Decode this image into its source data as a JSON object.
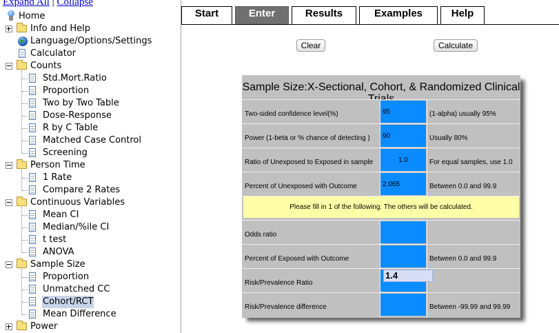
{
  "tree": {
    "expand_all": "Expand All",
    "separator": "|",
    "collapse": "Collapse",
    "nodes": [
      {
        "label": "Home",
        "icon": "home-icon",
        "level": 0
      },
      {
        "label": "Info and Help",
        "icon": "folder-icon",
        "level": 0,
        "toggle": "plus"
      },
      {
        "label": "Language/Options/Settings",
        "icon": "globe-icon",
        "level": 0
      },
      {
        "label": "Calculator",
        "icon": "document-icon",
        "level": 0
      },
      {
        "label": "Counts",
        "icon": "folder-open-icon",
        "level": 0,
        "toggle": "minus"
      },
      {
        "label": "Std.Mort.Ratio",
        "icon": "document-icon",
        "level": 1
      },
      {
        "label": "Proportion",
        "icon": "document-icon",
        "level": 1
      },
      {
        "label": "Two by Two Table",
        "icon": "document-icon",
        "level": 1
      },
      {
        "label": "Dose-Response",
        "icon": "document-icon",
        "level": 1
      },
      {
        "label": "R by C Table",
        "icon": "document-icon",
        "level": 1
      },
      {
        "label": "Matched Case Control",
        "icon": "document-icon",
        "level": 1
      },
      {
        "label": "Screening",
        "icon": "document-icon",
        "level": 1
      },
      {
        "label": "Person Time",
        "icon": "folder-open-icon",
        "level": 0,
        "toggle": "minus"
      },
      {
        "label": "1 Rate",
        "icon": "document-icon",
        "level": 1
      },
      {
        "label": "Compare 2 Rates",
        "icon": "document-icon",
        "level": 1
      },
      {
        "label": "Continuous Variables",
        "icon": "folder-open-icon",
        "level": 0,
        "toggle": "minus"
      },
      {
        "label": "Mean CI",
        "icon": "document-icon",
        "level": 1
      },
      {
        "label": "Median/%ile CI",
        "icon": "document-icon",
        "level": 1
      },
      {
        "label": "t test",
        "icon": "document-icon",
        "level": 1
      },
      {
        "label": "ANOVA",
        "icon": "document-icon",
        "level": 1
      },
      {
        "label": "Sample Size",
        "icon": "folder-open-icon",
        "level": 0,
        "toggle": "minus"
      },
      {
        "label": "Proportion",
        "icon": "document-icon",
        "level": 1
      },
      {
        "label": "Unmatched CC",
        "icon": "document-icon",
        "level": 1
      },
      {
        "label": "Cohort/RCT",
        "icon": "document-icon",
        "level": 1,
        "selected": true
      },
      {
        "label": "Mean Difference",
        "icon": "document-icon",
        "level": 1
      },
      {
        "label": "Power",
        "icon": "folder-icon",
        "level": 0,
        "toggle": "plus"
      }
    ]
  },
  "tabs": [
    {
      "label": "Start",
      "active": false
    },
    {
      "label": "Enter",
      "active": true
    },
    {
      "label": "Results",
      "active": false
    },
    {
      "label": "Examples",
      "active": false
    },
    {
      "label": "Help",
      "active": false
    }
  ],
  "buttons": {
    "clear": "Clear",
    "calculate": "Calculate"
  },
  "form": {
    "title": "Sample Size:X-Sectional, Cohort, & Randomized Clinical Trials",
    "rows": [
      {
        "label": "Two-sided confidence level(%)",
        "value": "95",
        "hint": "(1-alpha) usually 95%"
      },
      {
        "label": "Power (1-beta or % chance of detecting )",
        "value": "90",
        "hint": "Usually 80%"
      },
      {
        "label": "Ratio of Unexposed to Exposed in sample",
        "value": "1.0",
        "hint": "For equal samples, use 1.0"
      },
      {
        "label": "Percent of Unexposed with Outcome",
        "value": "2.065",
        "hint": "Between 0.0 and 99.9"
      }
    ],
    "instruction": "Please fill in 1 of the following. The others will be calculated.",
    "rows2": [
      {
        "label": "Odds ratio",
        "value": "",
        "hint": ""
      },
      {
        "label": "Percent of Exposed with Outcome",
        "value": "",
        "hint": "Between 0.0 and 99.9"
      },
      {
        "label": "Risk/Prevalence Ratio",
        "value": "",
        "hint": ""
      },
      {
        "label": "Risk/Prevalence difference",
        "value": "",
        "hint": "Between -99.99 and 99.99"
      }
    ],
    "editing_value": "1.4"
  },
  "colors": {
    "input_blue": "#0a8cff",
    "panel_gray": "#c0c0c0",
    "instruction_yellow": "#ffffa8",
    "active_tab": "#707070"
  }
}
